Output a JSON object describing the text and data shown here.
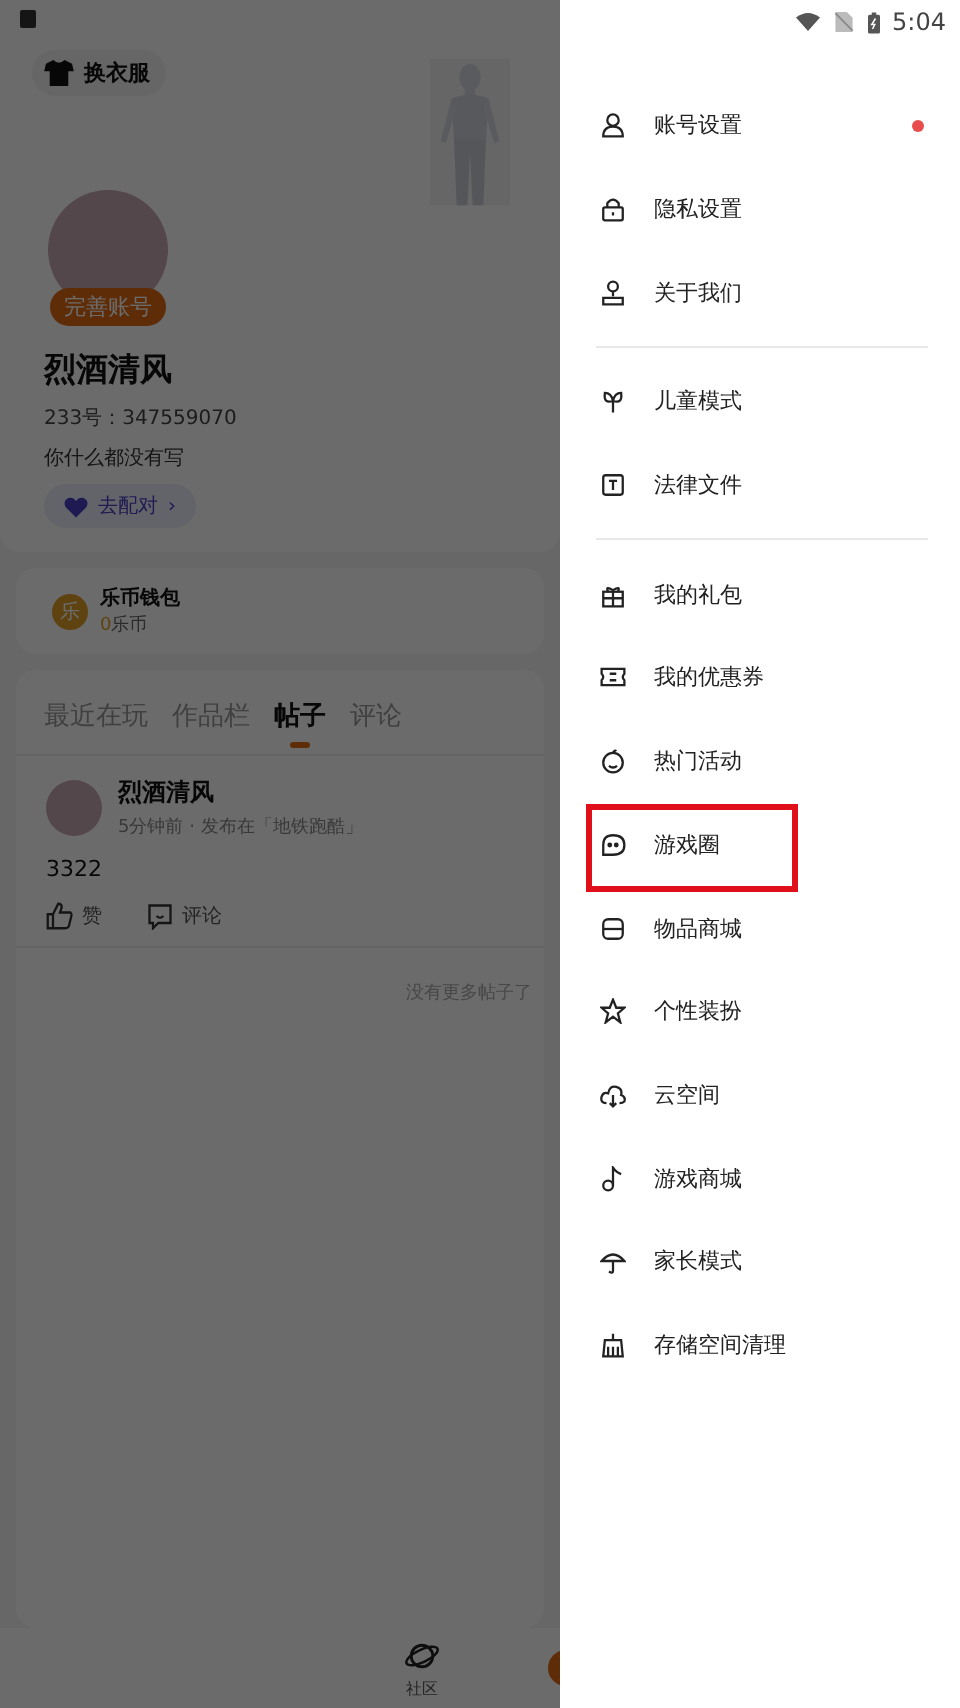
{
  "profile": {
    "outfit_button": "换衣服",
    "badge": "完善账号",
    "name": "烈酒清风",
    "id_line": "233号：347559070",
    "bio": "你什么都没有写",
    "match_button": "去配对",
    "match_arrow": "›"
  },
  "wallet": {
    "title": "乐币钱包",
    "amount": "0",
    "unit": "乐币",
    "coin": "乐"
  },
  "tabs": [
    {
      "label": "最近在玩",
      "selected": false
    },
    {
      "label": "作品栏",
      "selected": false
    },
    {
      "label": "帖子",
      "selected": true
    },
    {
      "label": "评论",
      "selected": false
    }
  ],
  "post": {
    "author": "烈酒清风",
    "meta": "5分钟前 · 发布在「地铁跑酷」",
    "content": "3322",
    "like": "赞",
    "comment": "评论"
  },
  "end_note": "没有更多帖子了",
  "bottom_nav": [
    {
      "label": "社区",
      "kind": "planet"
    },
    {
      "kind": "dot"
    }
  ],
  "status_bar": {
    "time": "5:04"
  },
  "drawer": {
    "groups": [
      [
        {
          "label": "账号设置",
          "badge": true,
          "highlighted": false
        },
        {
          "label": "隐私设置",
          "badge": false,
          "highlighted": false
        },
        {
          "label": "关于我们",
          "badge": false,
          "highlighted": false
        }
      ],
      [
        {
          "label": "儿童模式",
          "badge": false,
          "highlighted": false
        },
        {
          "label": "法律文件",
          "badge": false,
          "highlighted": false
        }
      ],
      [
        {
          "label": "我的礼包",
          "badge": false,
          "highlighted": false
        },
        {
          "label": "我的优惠券",
          "badge": false,
          "highlighted": false
        },
        {
          "label": "热门活动",
          "badge": false,
          "highlighted": false
        },
        {
          "label": "游戏圈",
          "badge": false,
          "highlighted": true
        },
        {
          "label": "物品商城",
          "badge": false,
          "highlighted": false
        },
        {
          "label": "个性装扮",
          "badge": false,
          "highlighted": false
        },
        {
          "label": "云空间",
          "badge": false,
          "highlighted": false
        },
        {
          "label": "游戏商城",
          "badge": false,
          "highlighted": false
        },
        {
          "label": "家长模式",
          "badge": false,
          "highlighted": false
        },
        {
          "label": "存储空间清理",
          "badge": false,
          "highlighted": false
        }
      ]
    ]
  }
}
